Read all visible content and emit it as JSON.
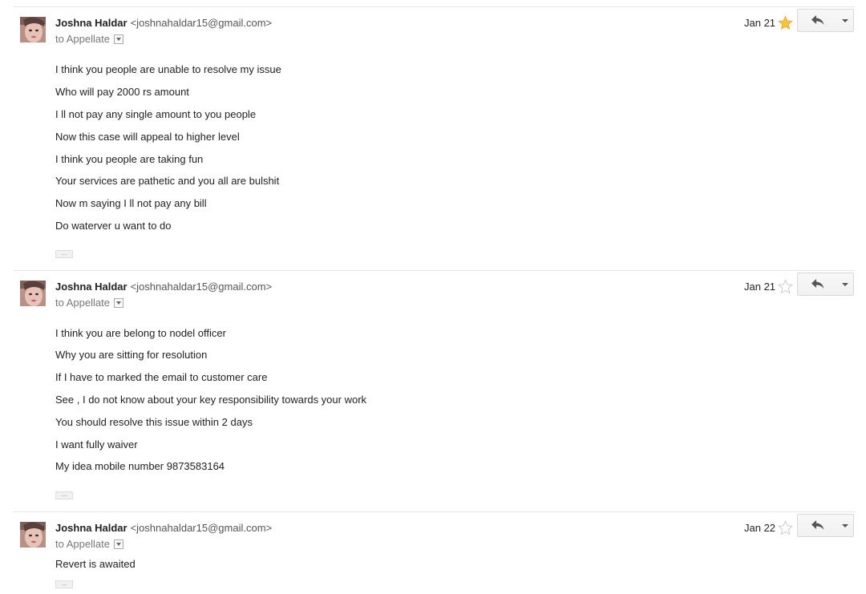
{
  "messages": [
    {
      "sender_name": "Joshna Haldar",
      "sender_email": "<joshnahaldar15@gmail.com>",
      "to": "to Appellate",
      "date": "Jan 21",
      "starred": true,
      "body": [
        "I think you people are unable to resolve my issue",
        "Who will pay 2000 rs amount",
        "I ll not pay any single amount to you people",
        "Now this case will appeal to higher level",
        "I think you people are taking fun",
        "Your services are pathetic and you all are bulshit",
        "Now m saying I ll not pay any bill",
        "Do waterver u want to do"
      ],
      "trimmed_content_label": "..."
    },
    {
      "sender_name": "Joshna Haldar",
      "sender_email": "<joshnahaldar15@gmail.com>",
      "to": "to Appellate",
      "date": "Jan 21",
      "starred": false,
      "body": [
        "I think you are belong to nodel officer",
        "Why you are sitting for resolution",
        "If I have to marked the email to customer care",
        "See , I do not know about your key responsibility towards your work",
        "You should resolve this issue within 2 days",
        "I want fully waiver",
        "My idea mobile number 9873583164"
      ],
      "trimmed_content_label": "..."
    },
    {
      "sender_name": "Joshna Haldar",
      "sender_email": "<joshnahaldar15@gmail.com>",
      "to": "to Appellate",
      "date": "Jan 22",
      "starred": false,
      "body": [
        "Revert is awaited"
      ],
      "trimmed_content_label": "..."
    }
  ],
  "icons": {
    "star_on": "star-filled",
    "star_off": "star-outline",
    "reply": "reply-arrow",
    "more": "chevron-down"
  },
  "colors": {
    "star_filled": "#f7c23f",
    "star_outline": "#c8c8c8"
  }
}
